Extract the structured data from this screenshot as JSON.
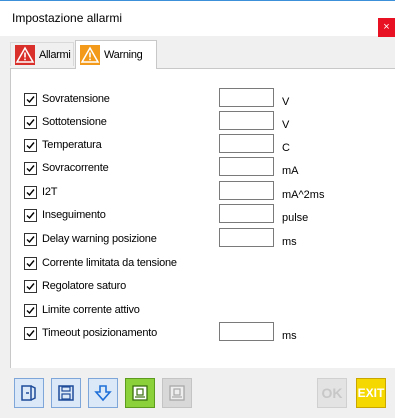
{
  "window": {
    "title": "Impostazione allarmi",
    "close_label": "×"
  },
  "tabs": [
    {
      "label": "Allarmi",
      "icon": "warning-triangle-red",
      "active": false
    },
    {
      "label": "Warning",
      "icon": "warning-triangle-orange",
      "active": true
    }
  ],
  "rows": [
    {
      "label": "Sovratensione",
      "checked": true,
      "value": "",
      "unit": "V"
    },
    {
      "label": "Sottotensione",
      "checked": true,
      "value": "",
      "unit": "V"
    },
    {
      "label": "Temperatura",
      "checked": true,
      "value": "",
      "unit": "C"
    },
    {
      "label": "Sovracorrente",
      "checked": true,
      "value": "",
      "unit": "mA"
    },
    {
      "label": "I2T",
      "checked": true,
      "value": "",
      "unit": "mA^2ms"
    },
    {
      "label": "Inseguimento",
      "checked": true,
      "value": "",
      "unit": "pulse"
    },
    {
      "label": "Delay warning posizione",
      "checked": true,
      "value": "",
      "unit": "ms"
    },
    {
      "label": "Corrente limitata da tensione",
      "checked": true
    },
    {
      "label": "Regolatore saturo",
      "checked": true
    },
    {
      "label": "Limite corrente attivo",
      "checked": true
    },
    {
      "label": "Timeout posizionamento",
      "checked": true,
      "value": "",
      "unit": "ms"
    }
  ],
  "toolbar": {
    "ok_label": "OK",
    "exit_label": "EXIT",
    "icons": [
      "open-file-icon",
      "save-icon",
      "download-icon",
      "write-to-device-icon",
      "read-from-device-icon"
    ]
  },
  "colors": {
    "close": "#e81123",
    "allarmi_icon": "#d9302c",
    "warning_icon": "#f39a1a",
    "exit": "#f5d800",
    "green_button": "#8bd23a"
  }
}
